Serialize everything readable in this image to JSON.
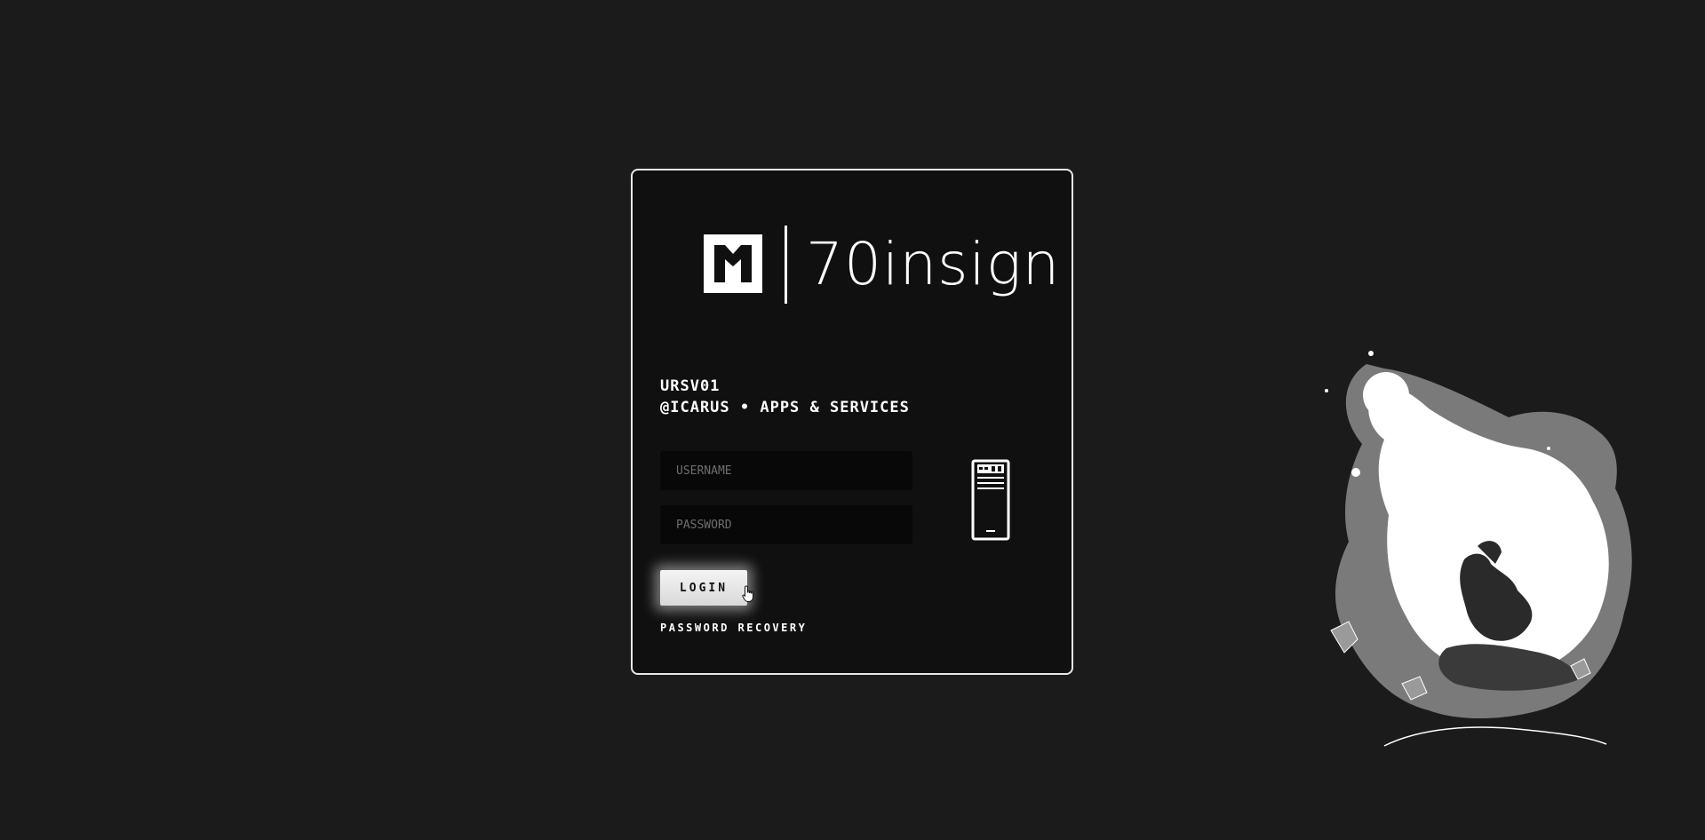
{
  "brand": {
    "name": "70insign"
  },
  "server": {
    "line1": "URSV01",
    "line2": "@ICARUS • APPS & SERVICES"
  },
  "form": {
    "username_placeholder": "USERNAME",
    "password_placeholder": "PASSWORD",
    "login_label": "LOGIN",
    "recovery_label": "PASSWORD RECOVERY"
  },
  "icons": {
    "logo": "brand-logo-icon",
    "server": "server-tower-icon",
    "cursor": "hand-pointer-icon",
    "art": "energy-ball-warrior-illustration"
  },
  "colors": {
    "background": "#1b1b1b",
    "card": "#101010",
    "card_border": "#e8e8e8",
    "text": "#ffffff",
    "input": "#080808"
  }
}
